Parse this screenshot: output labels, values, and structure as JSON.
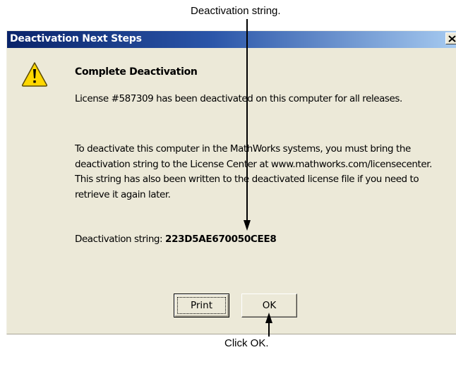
{
  "callouts": {
    "top": "Deactivation string.",
    "bottom": "Click OK."
  },
  "dialog": {
    "title": "Deactivation Next Steps",
    "close_label": "X",
    "icon": "warning-icon",
    "heading": "Complete Deactivation",
    "paragraph1": "License #587309 has been deactivated on this computer for all releases.",
    "paragraph2": "To deactivate this computer in the MathWorks systems, you must bring the deactivation string to the License Center at www.mathworks.com/licensecenter. This string has also been written to the deactivated license file if you need to retrieve it again later.",
    "deactivation_label": "Deactivation string: ",
    "deactivation_value": "223D5AE670050CEE8",
    "buttons": {
      "print": "Print",
      "ok": "OK"
    }
  },
  "colors": {
    "titlebar_start": "#0a246a",
    "titlebar_end": "#a6caf0",
    "dialog_bg": "#ece9d8",
    "warning_fill": "#ffd700"
  }
}
